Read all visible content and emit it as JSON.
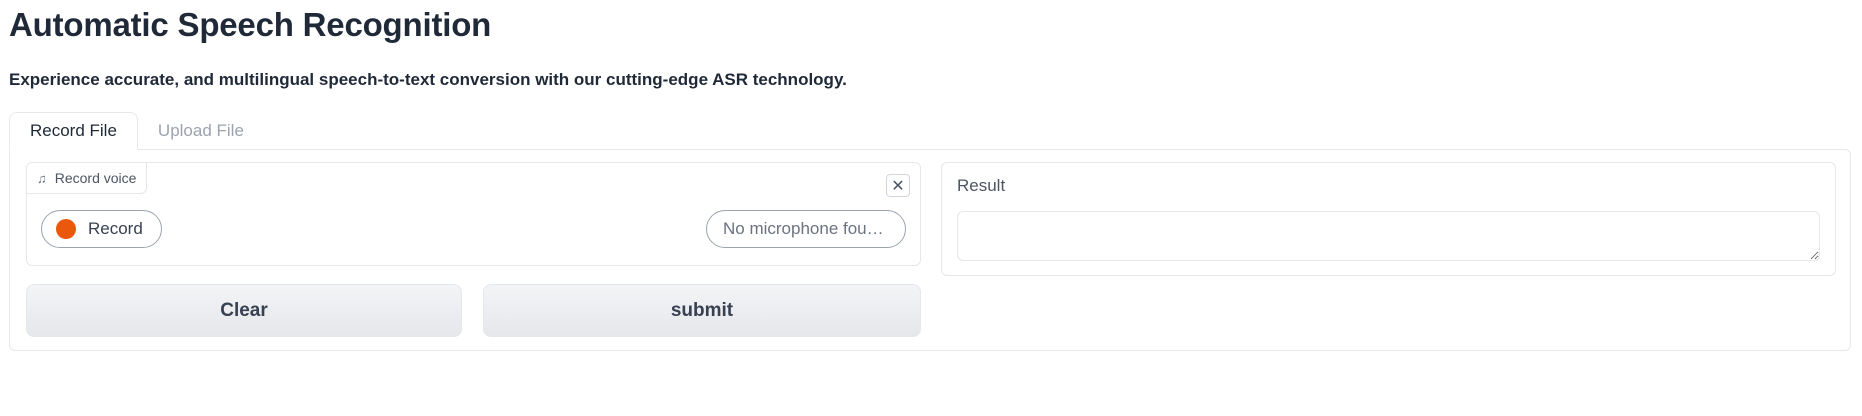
{
  "header": {
    "title": "Automatic Speech Recognition",
    "description": "Experience accurate, and multilingual speech-to-text conversion with our cutting-edge ASR technology."
  },
  "tabs": [
    {
      "label": "Record File",
      "active": true
    },
    {
      "label": "Upload File",
      "active": false
    }
  ],
  "audio": {
    "label": "Record voice",
    "label_icon": "music-note-icon",
    "record_label": "Record",
    "microphone_select": "No microphone fou…",
    "clear_icon": "close-icon"
  },
  "buttons": {
    "clear_label": "Clear",
    "submit_label": "submit"
  },
  "result": {
    "label": "Result",
    "value": ""
  },
  "colors": {
    "record_dot": "#ea580c",
    "text": "#1f2937",
    "border": "#e5e7eb"
  }
}
